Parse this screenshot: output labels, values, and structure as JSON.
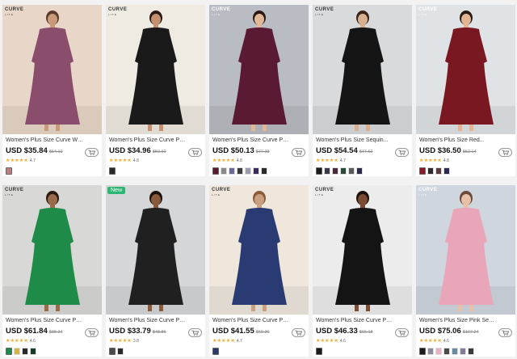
{
  "brand": {
    "logo": "CURVE",
    "tagline": "LITE"
  },
  "colors": {
    "star": "#f5a623",
    "new_badge": "#2bb673"
  },
  "products": [
    {
      "title": "Women's Plus Size Curve Wo...",
      "price": "USD $35.84",
      "old_price": "$54.10",
      "rating": "4.7",
      "stars": "★★★★★",
      "new": false,
      "swatches": [
        "#b88080"
      ],
      "bg": "#e8d7c8",
      "dress": "#8a4e6c"
    },
    {
      "title": "Women's Plus Size Curve Par...",
      "price": "USD $34.96",
      "old_price": "$50.60",
      "rating": "4.8",
      "stars": "★★★★★",
      "new": false,
      "swatches": [
        "#2a2a2a"
      ],
      "bg": "#efeae2",
      "dress": "#1a1a1a"
    },
    {
      "title": "Women's Plus Size Curve Par...",
      "price": "USD $50.13",
      "old_price": "$77.38",
      "rating": "4.8",
      "stars": "★★★★★",
      "new": false,
      "swatches": [
        "#5a1a2e",
        "#8a8a8a",
        "#6a6a9a",
        "#3a3a3a",
        "#9a9aaa",
        "#3a2a5a",
        "#2a2a2a"
      ],
      "bg": "#b9bcc2",
      "dress": "#5a1a34"
    },
    {
      "title": "Women's Plus Size Sequin...",
      "price": "USD $54.54",
      "old_price": "$77.62",
      "rating": "4.7",
      "stars": "★★★★★",
      "new": false,
      "swatches": [
        "#1a1a1a",
        "#3a3a4a",
        "#4a2a3a",
        "#2a4a3a",
        "#5a5a5a",
        "#2a2a4a"
      ],
      "bg": "#d9dadc",
      "dress": "#151515"
    },
    {
      "title": "Women's Plus Size Red...",
      "price": "USD $36.50",
      "old_price": "$52.14",
      "rating": "4.8",
      "stars": "★★★★★",
      "new": false,
      "swatches": [
        "#8a1a2a",
        "#2a2a2a",
        "#5a3a3a",
        "#2a2a4a"
      ],
      "bg": "#dfe3e6",
      "dress": "#7a1822"
    },
    {
      "title": "Women's Plus Size Curve Par...",
      "price": "USD $61.84",
      "old_price": "$88.34",
      "rating": "4.6",
      "stars": "★★★★★",
      "new": false,
      "swatches": [
        "#1e8a4a",
        "#d4b44a",
        "#2a2a2a",
        "#1a3a2a"
      ],
      "bg": "#d8d8d6",
      "dress": "#1e8c48"
    },
    {
      "title": "Women's Plus Size Curve Par...",
      "price": "USD $33.79",
      "old_price": "$48.86",
      "rating": "3.8",
      "stars": "★★★★★",
      "new": true,
      "new_label": "New",
      "swatches": [
        "#4a4a4a",
        "#2a2a2a"
      ],
      "bg": "#d4d6d8",
      "dress": "#202020"
    },
    {
      "title": "Women's Plus Size Curve Pro...",
      "price": "USD $41.55",
      "old_price": "$60.36",
      "rating": "4.7",
      "stars": "★★★★★",
      "new": false,
      "swatches": [
        "#2a3a6a"
      ],
      "bg": "#efe7dc",
      "dress": "#2a3a72"
    },
    {
      "title": "Women's Plus Size Curve Par...",
      "price": "USD $46.33",
      "old_price": "$66.18",
      "rating": "4.6",
      "stars": "★★★★★",
      "new": false,
      "swatches": [
        "#1a1a1a"
      ],
      "bg": "#ececec",
      "dress": "#141414"
    },
    {
      "title": "Women's Plus Size Pink Sequ...",
      "price": "USD $75.06",
      "old_price": "$107.24",
      "rating": "4.6",
      "stars": "★★★★★",
      "new": false,
      "swatches": [
        "#1a1a1a",
        "#8a8a9a",
        "#e8b0c0",
        "#4a4a4a",
        "#6a8aa0",
        "#8a7a9a",
        "#3a3a3a"
      ],
      "bg": "#cfd6de",
      "dress": "#e9a6b8"
    }
  ]
}
